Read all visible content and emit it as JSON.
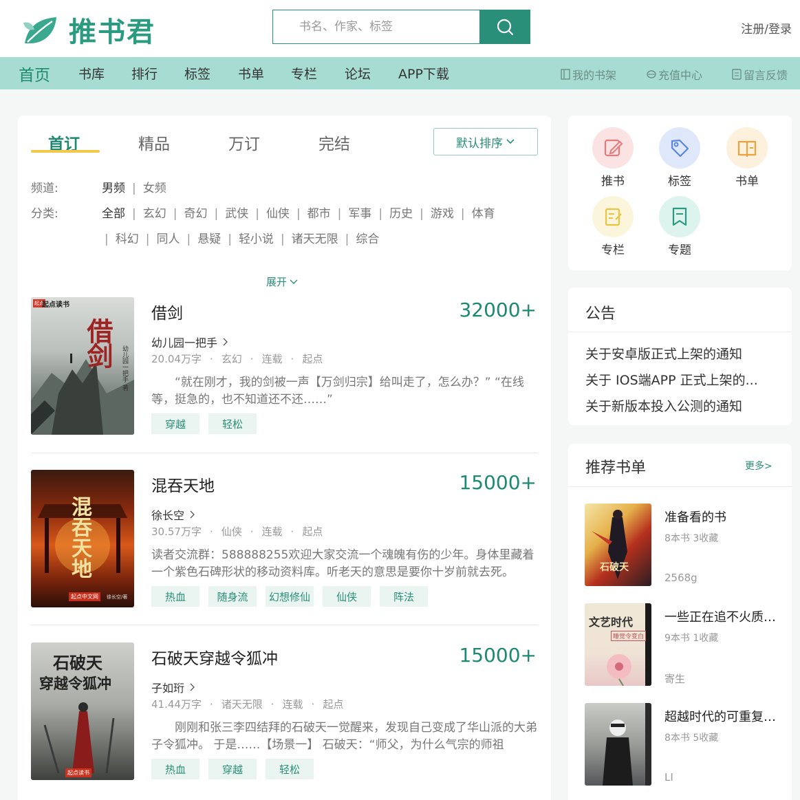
{
  "header": {
    "logo_text": "推书君",
    "search_placeholder": "书名、作家、标签",
    "login_label": "注册/登录"
  },
  "nav": {
    "items": [
      "首页",
      "书库",
      "排行",
      "标签",
      "书单",
      "专栏",
      "论坛",
      "APP下载"
    ],
    "right": [
      "我的书架",
      "充值中心",
      "留言反馈"
    ]
  },
  "tabs": [
    "首订",
    "精品",
    "万订",
    "完结"
  ],
  "sort_label": "默认排序",
  "filters": {
    "channel_label": "频道:",
    "channels": [
      "男频",
      "女频"
    ],
    "category_label": "分类:",
    "categories_row1": [
      "全部",
      "玄幻",
      "奇幻",
      "武侠",
      "仙侠",
      "都市",
      "军事",
      "历史",
      "游戏",
      "体育"
    ],
    "categories_row2": [
      "科幻",
      "同人",
      "悬疑",
      "轻小说",
      "诸天无限",
      "综合"
    ],
    "expand_label": "展开"
  },
  "books": [
    {
      "title": "借剑",
      "count": "32000+",
      "author": "幼儿园一把手",
      "words": "20.04万字",
      "genre": "玄幻",
      "status": "连载",
      "source": "起点",
      "desc": "“就在刚才，我的剑被一声【万剑归宗】给叫走了，怎么办？” “在线等，挺急的，也不知道还不还……”",
      "tags": [
        "穿越",
        "轻松"
      ],
      "cover_brand": "起点读书",
      "cover_title": "借剑",
      "cover_side": "幼儿园一把手 著"
    },
    {
      "title": "混吞天地",
      "count": "15000+",
      "author": "徐长空",
      "words": "30.57万字",
      "genre": "仙侠",
      "status": "连载",
      "source": "起点",
      "desc": "读者交流群：588888255欢迎大家交流一个魂魄有伤的少年。身体里藏着一个紫色石碑形状的移动资料库。听老天的意思是要你十岁前就去死。",
      "tags": [
        "热血",
        "随身流",
        "幻想修仙",
        "仙侠",
        "阵法"
      ],
      "cover_brand": "起点中文网",
      "cover_title": "混吞天地",
      "cover_side": "徐长空/著"
    },
    {
      "title": "石破天穿越令狐冲",
      "count": "15000+",
      "author": "子如珩",
      "words": "41.44万字",
      "genre": "诸天无限",
      "status": "连载",
      "source": "起点",
      "desc": "刚刚和张三李四结拜的石破天一觉醒来，发现自己变成了华山派的大弟子令狐冲。 于是……【场景一】 石破天：“师父，为什么气宗的师祖",
      "tags": [
        "热血",
        "穿越",
        "轻松"
      ],
      "cover_brand": "起点读书",
      "cover_title_line1": "石破天",
      "cover_title_line2": "穿越令狐冲"
    }
  ],
  "quick_links": [
    "推书",
    "标签",
    "书单",
    "专栏",
    "专题"
  ],
  "notice": {
    "title": "公告",
    "items": [
      "关于安卓版正式上架的通知",
      "关于 IOS端APP 正式上架的...",
      "关于新版本投入公测的通知"
    ]
  },
  "booklists": {
    "title": "推荐书单",
    "more": "更多>",
    "items": [
      {
        "title": "准备看的书",
        "meta": "8本书 3收藏",
        "user": "2568g",
        "cover_text": "石破天"
      },
      {
        "title": "一些正在追不火质量...",
        "meta": "9本书 1收藏",
        "user": "寄生",
        "cover_text": "文艺时代",
        "cover_sub": "睡觉令变白"
      },
      {
        "title": "超越时代的可重复观...",
        "meta": "8本书 5收藏",
        "user": "LI"
      }
    ]
  },
  "colors": {
    "brand": "#2a8f78",
    "nav_bg": "#a7dcd2",
    "accent_underline": "#f2c94c"
  }
}
